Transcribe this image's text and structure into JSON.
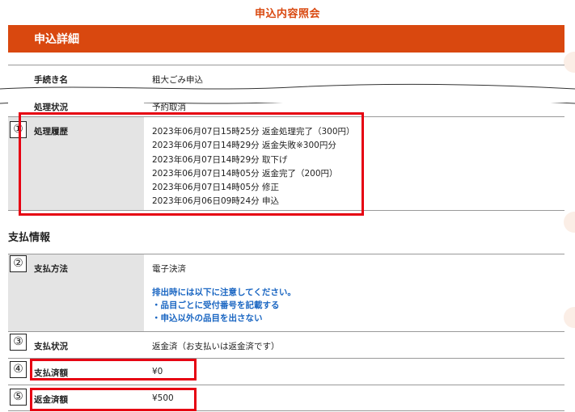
{
  "page_title": "申込内容照会",
  "section_header": "申込詳細",
  "procedure": {
    "label": "手続き名",
    "value": "粗大ごみ申込"
  },
  "status": {
    "label": "処理状況",
    "value": "予約取消"
  },
  "history": {
    "label": "処理履歴",
    "entries": [
      "2023年06月07日15時25分 返金処理完了（300円）",
      "2023年06月07日14時29分 返金失敗※300円分",
      "2023年06月07日14時29分 取下げ",
      "2023年06月07日14時05分 返金完了（200円）",
      "2023年06月07日14時05分 修正",
      "2023年06月06日09時24分 申込"
    ]
  },
  "payment_heading": "支払情報",
  "payment_method": {
    "label": "支払方法",
    "value": "電子決済",
    "notice": [
      "排出時には以下に注意してください。",
      "・品目ごとに受付番号を記載する",
      "・申込以外の品目を出さない"
    ]
  },
  "payment_status": {
    "label": "支払状況",
    "value": "返金済（お支払いは返金済です）"
  },
  "paid_amount": {
    "label": "支払済額",
    "value": "¥0"
  },
  "refund_amount": {
    "label": "返金済額",
    "value": "¥500"
  },
  "markers": [
    "①",
    "②",
    "③",
    "④",
    "⑤"
  ],
  "colors": {
    "accent": "#d9480f",
    "highlight": "#e60012",
    "notice": "#1a66c2"
  }
}
